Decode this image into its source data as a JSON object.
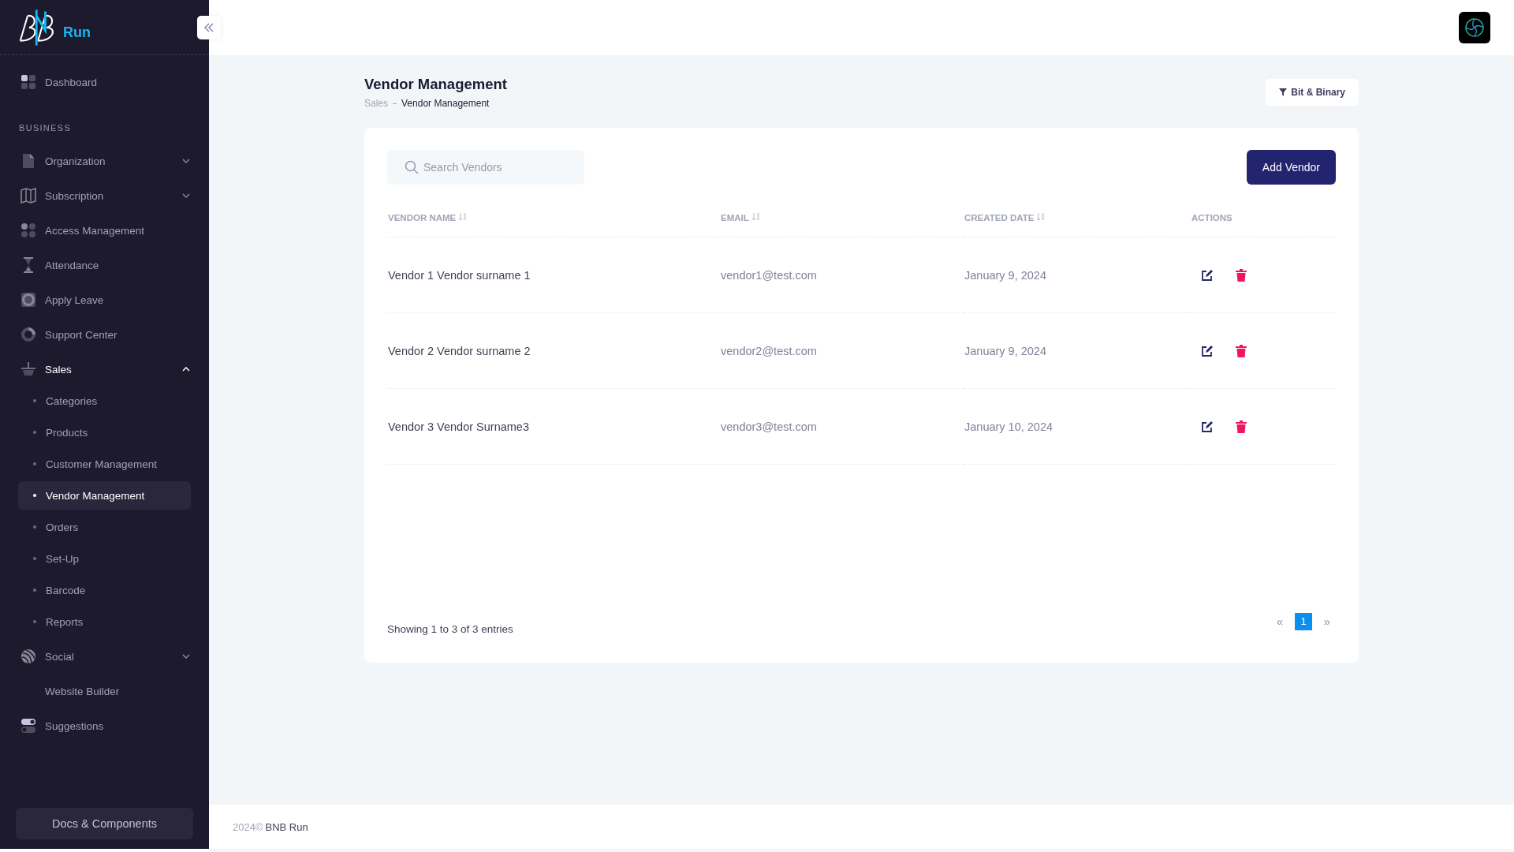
{
  "sidebar": {
    "logo": {
      "text": "Run"
    },
    "items": [
      {
        "kind": "link",
        "label": "Dashboard",
        "selected": false
      },
      {
        "kind": "heading",
        "label": "BUSINESS"
      },
      {
        "kind": "group",
        "label": "Organization",
        "expanded": false
      },
      {
        "kind": "group",
        "label": "Subscription",
        "expanded": false
      },
      {
        "kind": "link",
        "label": "Access Management",
        "selected": false
      },
      {
        "kind": "link",
        "label": "Attendance",
        "selected": false
      },
      {
        "kind": "link",
        "label": "Apply Leave",
        "selected": false
      },
      {
        "kind": "link",
        "label": "Support Center",
        "selected": false
      },
      {
        "kind": "group",
        "label": "Sales",
        "expanded": true,
        "children": [
          {
            "label": "Categories",
            "selected": false
          },
          {
            "label": "Products",
            "selected": false
          },
          {
            "label": "Customer Management",
            "selected": false
          },
          {
            "label": "Vendor Management",
            "selected": true
          },
          {
            "label": "Orders",
            "selected": false
          },
          {
            "label": "Set-Up",
            "selected": false
          },
          {
            "label": "Barcode",
            "selected": false
          },
          {
            "label": "Reports",
            "selected": false
          }
        ]
      },
      {
        "kind": "group",
        "label": "Social",
        "expanded": false
      },
      {
        "kind": "plain",
        "label": "Website Builder",
        "selected": false
      },
      {
        "kind": "link",
        "label": "Suggestions",
        "selected": false
      }
    ],
    "docs_button": "Docs & Components"
  },
  "page": {
    "title": "Vendor Management",
    "breadcrumb": [
      "Sales",
      "Vendor Management"
    ],
    "filter_button": "Bit & Binary"
  },
  "search": {
    "placeholder": "Search Vendors"
  },
  "add_button": "Add Vendor",
  "table": {
    "columns": [
      {
        "label": "VENDOR NAME",
        "sortable": true
      },
      {
        "label": "EMAIL",
        "sortable": true
      },
      {
        "label": "CREATED DATE",
        "sortable": true
      },
      {
        "label": "ACTIONS",
        "sortable": false
      }
    ],
    "rows": [
      {
        "name": "Vendor 1 Vendor surname 1",
        "email": "vendor1@test.com",
        "created": "January 9, 2024"
      },
      {
        "name": "Vendor 2 Vendor surname 2",
        "email": "vendor2@test.com",
        "created": "January 9, 2024"
      },
      {
        "name": "Vendor 3 Vendor Surname3",
        "email": "vendor3@test.com",
        "created": "January 10, 2024"
      }
    ]
  },
  "entries_info": "Showing 1 to 3 of 3 entries",
  "pagination": [
    {
      "label": "«",
      "kind": "arrow",
      "disabled": true
    },
    {
      "label": "1",
      "kind": "page",
      "selected": true
    },
    {
      "label": "»",
      "kind": "arrow",
      "disabled": true
    }
  ],
  "footer": {
    "year": "2024©",
    "brand": "BNB Run"
  }
}
